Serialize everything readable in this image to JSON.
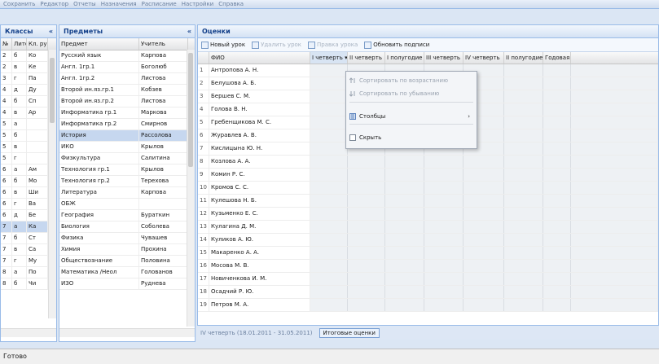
{
  "toolbar_top": [
    "Сохранить",
    "Редактор",
    "Отчеты",
    "Назначения",
    "Расписание",
    "Настройки",
    "Справка"
  ],
  "classes": {
    "title": "Классы",
    "columns": [
      "№",
      "Литера",
      "Кл. рук."
    ],
    "rows": [
      [
        "2",
        "б",
        "Ко"
      ],
      [
        "2",
        "в",
        "Ке"
      ],
      [
        "3",
        "г",
        "Па"
      ],
      [
        "4",
        "д",
        "Ду"
      ],
      [
        "4",
        "б",
        "Сп"
      ],
      [
        "4",
        "в",
        "Ар"
      ],
      [
        "5",
        "а",
        ""
      ],
      [
        "5",
        "б",
        ""
      ],
      [
        "5",
        "в",
        ""
      ],
      [
        "5",
        "г",
        ""
      ],
      [
        "6",
        "а",
        "Ам"
      ],
      [
        "6",
        "б",
        "Мо"
      ],
      [
        "6",
        "в",
        "Ши"
      ],
      [
        "6",
        "г",
        "Ва"
      ],
      [
        "6",
        "д",
        "Бе"
      ],
      [
        "7",
        "а",
        "Ка"
      ],
      [
        "7",
        "б",
        "Ст"
      ],
      [
        "7",
        "в",
        "Са"
      ],
      [
        "7",
        "г",
        "Му"
      ],
      [
        "8",
        "а",
        "По"
      ],
      [
        "8",
        "б",
        "Чи"
      ]
    ],
    "selected_index": 15
  },
  "subjects": {
    "title": "Предметы",
    "columns": [
      "Предмет",
      "Учитель"
    ],
    "rows": [
      [
        "Русский язык",
        "Карпова"
      ],
      [
        "Англ. 1гр.1",
        "Боголюб"
      ],
      [
        "Англ. 1гр.2",
        "Листова"
      ],
      [
        "Второй ин.яз.гр.1",
        "Кобзев"
      ],
      [
        "Второй ин.яз.гр.2",
        "Листова"
      ],
      [
        "Информатика гр.1",
        "Маркова"
      ],
      [
        "Информатика гр.2",
        "Смирнов"
      ],
      [
        "История",
        "Рассолова"
      ],
      [
        "ИКО",
        "Крылов"
      ],
      [
        "Физкультура",
        "Салитина"
      ],
      [
        "Технология гр.1",
        "Крылов"
      ],
      [
        "Технология гр.2",
        "Терехова"
      ],
      [
        "Литература",
        "Карпова"
      ],
      [
        "ОБЖ",
        ""
      ],
      [
        "География",
        "Бураткин"
      ],
      [
        "Биология",
        "Соболева"
      ],
      [
        "Физика",
        "Чувашев"
      ],
      [
        "Химия",
        "Прохина"
      ],
      [
        "Обществознание",
        "Половина"
      ],
      [
        "Математика /Неол",
        "Голованов"
      ],
      [
        "ИЗО",
        "Руднева"
      ]
    ],
    "selected_index": 7
  },
  "grades": {
    "title": "Оценки",
    "toolbar": {
      "new_lesson": "Новый урок",
      "delete_lesson": "Удалить урок",
      "edit_lesson": "Правка урока",
      "refresh": "Обновить подписи"
    },
    "columns": [
      "ФИО",
      "I четверть",
      "II четверть",
      "I полугодие",
      "III четверть",
      "IV четверть",
      "II полугодие",
      "Годовая"
    ],
    "students": [
      "Антропова А. Н.",
      "Белушова А. Б.",
      "Бершев С. М.",
      "Голова В. Н.",
      "Гребенщикова М. С.",
      "Журавлев А. В.",
      "Кислицына Ю. Н.",
      "Козлова А. А.",
      "Комин Р. С.",
      "Кромов С. С.",
      "Кулешова Н. Б.",
      "Кузьменко Е. С.",
      "Кулагина Д. М.",
      "Куликов А. Ю.",
      "Макаренко А. А.",
      "Мосова М. В.",
      "Новиченкова И. М.",
      "Осадчий Р. Ю.",
      "Петров М. А."
    ],
    "underlined": [
      2,
      5,
      8,
      11,
      13,
      14,
      17
    ]
  },
  "column_menu": {
    "items": [
      "Сортировать по возрастанию",
      "Сортировать по убыванию",
      "Столбцы",
      "Скрыть"
    ],
    "disabled": [
      0,
      1
    ]
  },
  "bottom_bar": {
    "period": "IV четверть (18.01.2011 - 31.05.2011)",
    "final_grades_tab": "Итоговые оценки"
  },
  "status": "Готово",
  "colors": {
    "panel_border": "#99bbe8",
    "header_text": "#15428b",
    "selected_row": "#c6d7ef"
  }
}
